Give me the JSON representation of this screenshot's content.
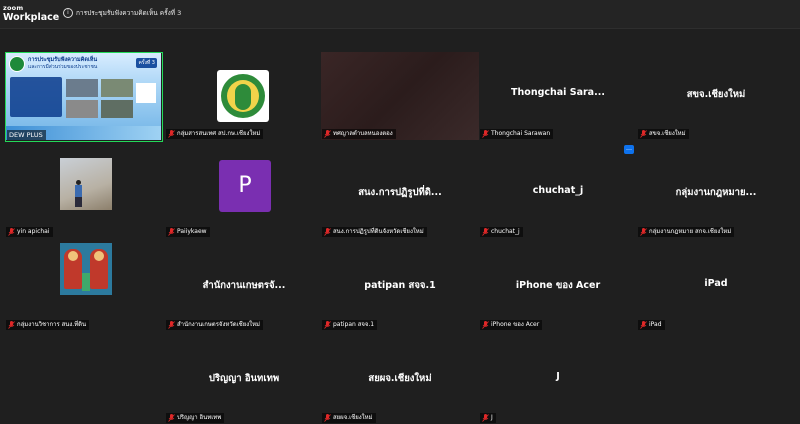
{
  "app": {
    "logo_top": "zoom",
    "logo_bottom": "Workplace"
  },
  "meeting": {
    "title": "การประชุมรับฟังความคิดเห็น ครั้งที่ 3"
  },
  "tiles": [
    {
      "type": "slide",
      "label": "การประชุมรับฟังความคิดเห็น ครั้งที่ 3",
      "slide_title1": "การประชุมรับฟังความคิดเห็น",
      "slide_title2": "และการมีส่วนร่วมของประชาชน",
      "badge": "ครั้งที่ 3",
      "share_tag": "DEW PLUS"
    },
    {
      "type": "logo",
      "label": "กลุ่มสารสนเทศ สป.กษ.เชียงใหม่"
    },
    {
      "type": "blur",
      "label": "ทศญาลตำบลหนองตอง"
    },
    {
      "type": "name",
      "name": "Thongchai  Sara...",
      "label": "Thongchai Sarawan"
    },
    {
      "type": "name",
      "name": "สขจ.เชียงใหม่",
      "label": "สขจ.เชียงใหม่"
    },
    {
      "type": "photo",
      "label": "yin apichai"
    },
    {
      "type": "letter",
      "letter": "P",
      "label": "Paiiykaew"
    },
    {
      "type": "name",
      "name": "สนง.การปฏิรูปที่ดิ...",
      "label": "สนง.การปฏิรูปที่ดินจังหวัดเชียงใหม่"
    },
    {
      "type": "name",
      "name": "chuchat_j",
      "label": "chuchat_j"
    },
    {
      "type": "name",
      "name": "กลุ่มงานกฎหมาย...",
      "label": "กลุ่มงานกฎหมาย สกจ.เชียงใหม่"
    },
    {
      "type": "art",
      "label": "กลุ่มงานวิชาการ สนง.ที่ดิน"
    },
    {
      "type": "name",
      "name": "สำนักงานเกษตรจั...",
      "label": "สำนักงานเกษตรจังหวัดเชียงใหม่"
    },
    {
      "type": "name",
      "name": "patipan สจจ.1",
      "label": "patipan สจจ.1"
    },
    {
      "type": "name",
      "name": "iPhone ของ Acer",
      "label": "iPhone ของ Acer"
    },
    {
      "type": "name",
      "name": "iPad",
      "label": "iPad"
    },
    {
      "type": "name",
      "name": "ปริญญา อินทเทพ",
      "label": "ปริญญา อินทเทพ"
    },
    {
      "type": "name",
      "name": "สยผจ.เชียงใหม่",
      "label": "สยผจ.เชียงใหม่"
    },
    {
      "type": "name",
      "name": "J",
      "label": "J"
    }
  ],
  "colors": {
    "background": "#1f1f1f",
    "active_speaker": "#23d959",
    "mic_muted": "#e02828",
    "avatar": "#7a2fb1"
  }
}
